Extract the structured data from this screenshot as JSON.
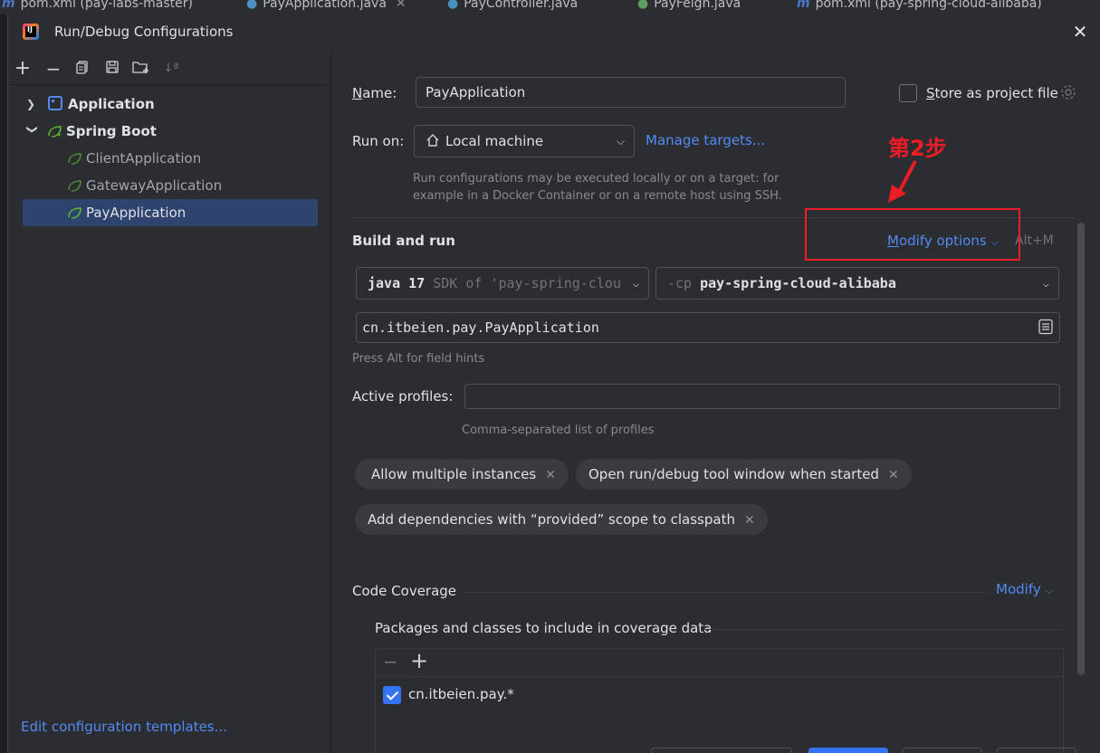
{
  "background_tabs": [
    {
      "label": "pom.xml (pay-labs-master)",
      "icon": "maven-icon"
    },
    {
      "label": "PayApplication.java",
      "icon": "java-class-icon"
    },
    {
      "label": "PayController.java",
      "icon": "java-class-icon"
    },
    {
      "label": "PayFeign.java",
      "icon": "java-interface-icon"
    },
    {
      "label": "pom.xml (pay-spring-cloud-alibaba)",
      "icon": "maven-icon"
    }
  ],
  "dialog": {
    "title": "Run/Debug Configurations",
    "close_icon": "close-icon"
  },
  "left": {
    "toolbar": [
      "add-icon",
      "remove-icon",
      "copy-icon",
      "save-icon",
      "new-folder-icon",
      "sort-icon"
    ],
    "tree": [
      {
        "label": "Application",
        "level": 0,
        "expanded": false,
        "icon": "application-icon"
      },
      {
        "label": "Spring Boot",
        "level": 0,
        "expanded": true,
        "icon": "spring-boot-icon"
      },
      {
        "label": "ClientApplication",
        "level": 1,
        "icon": "spring-boot-icon"
      },
      {
        "label": "GatewayApplication",
        "level": 1,
        "icon": "spring-boot-icon"
      },
      {
        "label": "PayApplication",
        "level": 1,
        "icon": "spring-boot-icon",
        "selected": true
      }
    ],
    "edit_templates": "Edit configuration templates..."
  },
  "right": {
    "name_label_first": "N",
    "name_label_rest": "ame:",
    "name_value": "PayApplication",
    "store_first": "S",
    "store_rest": "tore as project file",
    "store_checked": false,
    "run_on_label": "Run on:",
    "run_on_value": "Local machine",
    "manage_targets": "Manage targets...",
    "run_hint_1": "Run configurations may be executed locally or on a target: for",
    "run_hint_2": "example in a Docker Container or on a remote host using SSH.",
    "build_title": "Build and run",
    "modify_first": "M",
    "modify_rest": "odify options",
    "modify_shortcut": "Alt+M",
    "java_version": "java 17",
    "sdk_text": "SDK of 'pay-spring-clou",
    "cp_prefix": "-cp",
    "cp_module": "pay-spring-cloud-alibaba",
    "main_class": "cn.itbeien.pay.PayApplication",
    "field_hints": "Press Alt for field hints",
    "active_profiles_label": "Active profiles:",
    "active_profiles_value": "",
    "profiles_hint": "Comma-separated list of profiles",
    "chips": [
      "Allow multiple instances",
      "Open run/debug tool window when started",
      "Add dependencies with “provided” scope to classpath"
    ],
    "code_coverage_label": "Code Coverage",
    "coverage_modify": "Modify",
    "packages_label": "Packages and classes to include in coverage data",
    "packages": [
      {
        "pattern": "cn.itbeien.pay.*",
        "checked": true
      }
    ]
  },
  "annotation": {
    "text": "第2步",
    "color": "#ee1c25"
  },
  "colors": {
    "accent": "#548af7",
    "selection": "#2e436e",
    "checkbox": "#3574f0"
  }
}
